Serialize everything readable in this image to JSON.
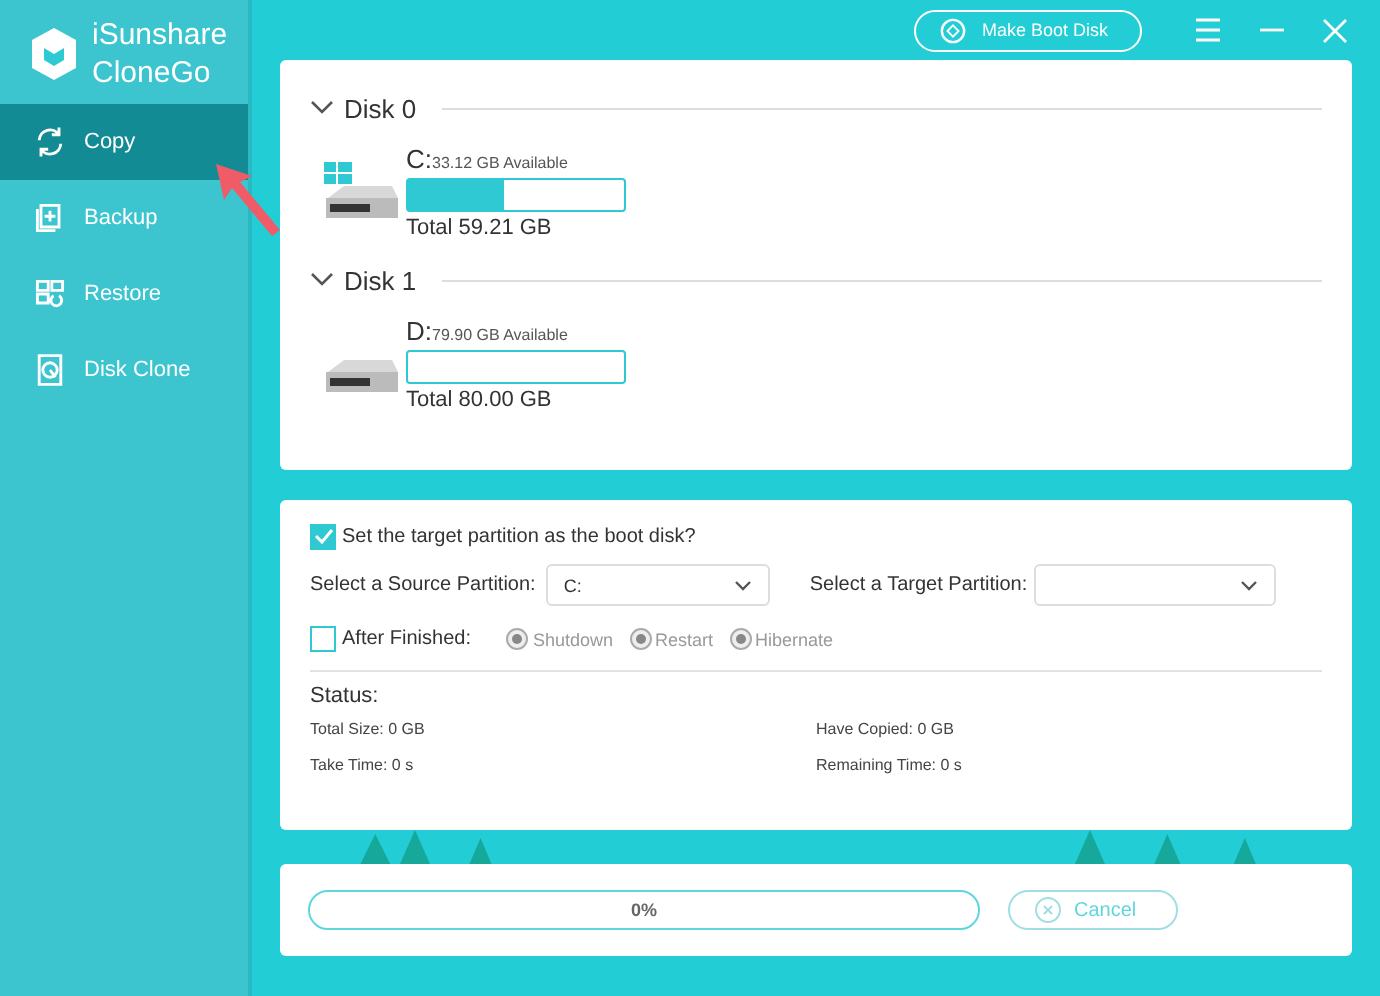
{
  "app": {
    "name_line_1": "iSunshare",
    "name_line_2": "CloneGo"
  },
  "sidebar": {
    "items": [
      {
        "label": "Copy",
        "selected": true
      },
      {
        "label": "Backup",
        "selected": false
      },
      {
        "label": "Restore",
        "selected": false
      },
      {
        "label": "Disk Clone",
        "selected": false
      }
    ]
  },
  "toolbar": {
    "make_boot_disk": "Make Boot Disk"
  },
  "disks": [
    {
      "title": "Disk 0",
      "expanded": true,
      "partitions": [
        {
          "letter": "C:",
          "available": "33.12 GB Available",
          "total": "Total 59.21 GB",
          "level": 0.44,
          "system": true
        }
      ]
    },
    {
      "title": "Disk 1",
      "expanded": true,
      "partitions": [
        {
          "letter": "D:",
          "available": "79.90 GB Available",
          "total": "Total 80.00 GB",
          "level": 0.0,
          "system": false
        }
      ]
    }
  ],
  "options": {
    "boot_disk": {
      "label": "Set the target partition as the boot disk?",
      "checked": true
    },
    "source_label": "Select a Source Partition:",
    "source_value": "C:",
    "target_label": "Select a Target Partition:",
    "after_finished": {
      "label": "After Finished:",
      "checked": false
    },
    "actions": [
      {
        "label": "Shutdown",
        "selected": true,
        "disabled": true
      },
      {
        "label": "Restart",
        "selected": true,
        "disabled": true
      },
      {
        "label": "Hibernate",
        "selected": true,
        "disabled": true
      }
    ]
  },
  "status": {
    "title": "Status:",
    "items": [
      "Total Size: 0 GB",
      "Have Copied: 0 GB",
      "Take Time: 0 s",
      "Remaining Time: 0 s"
    ]
  },
  "progress": {
    "text": "0%",
    "level": 0.0,
    "cancel": "Cancel"
  }
}
